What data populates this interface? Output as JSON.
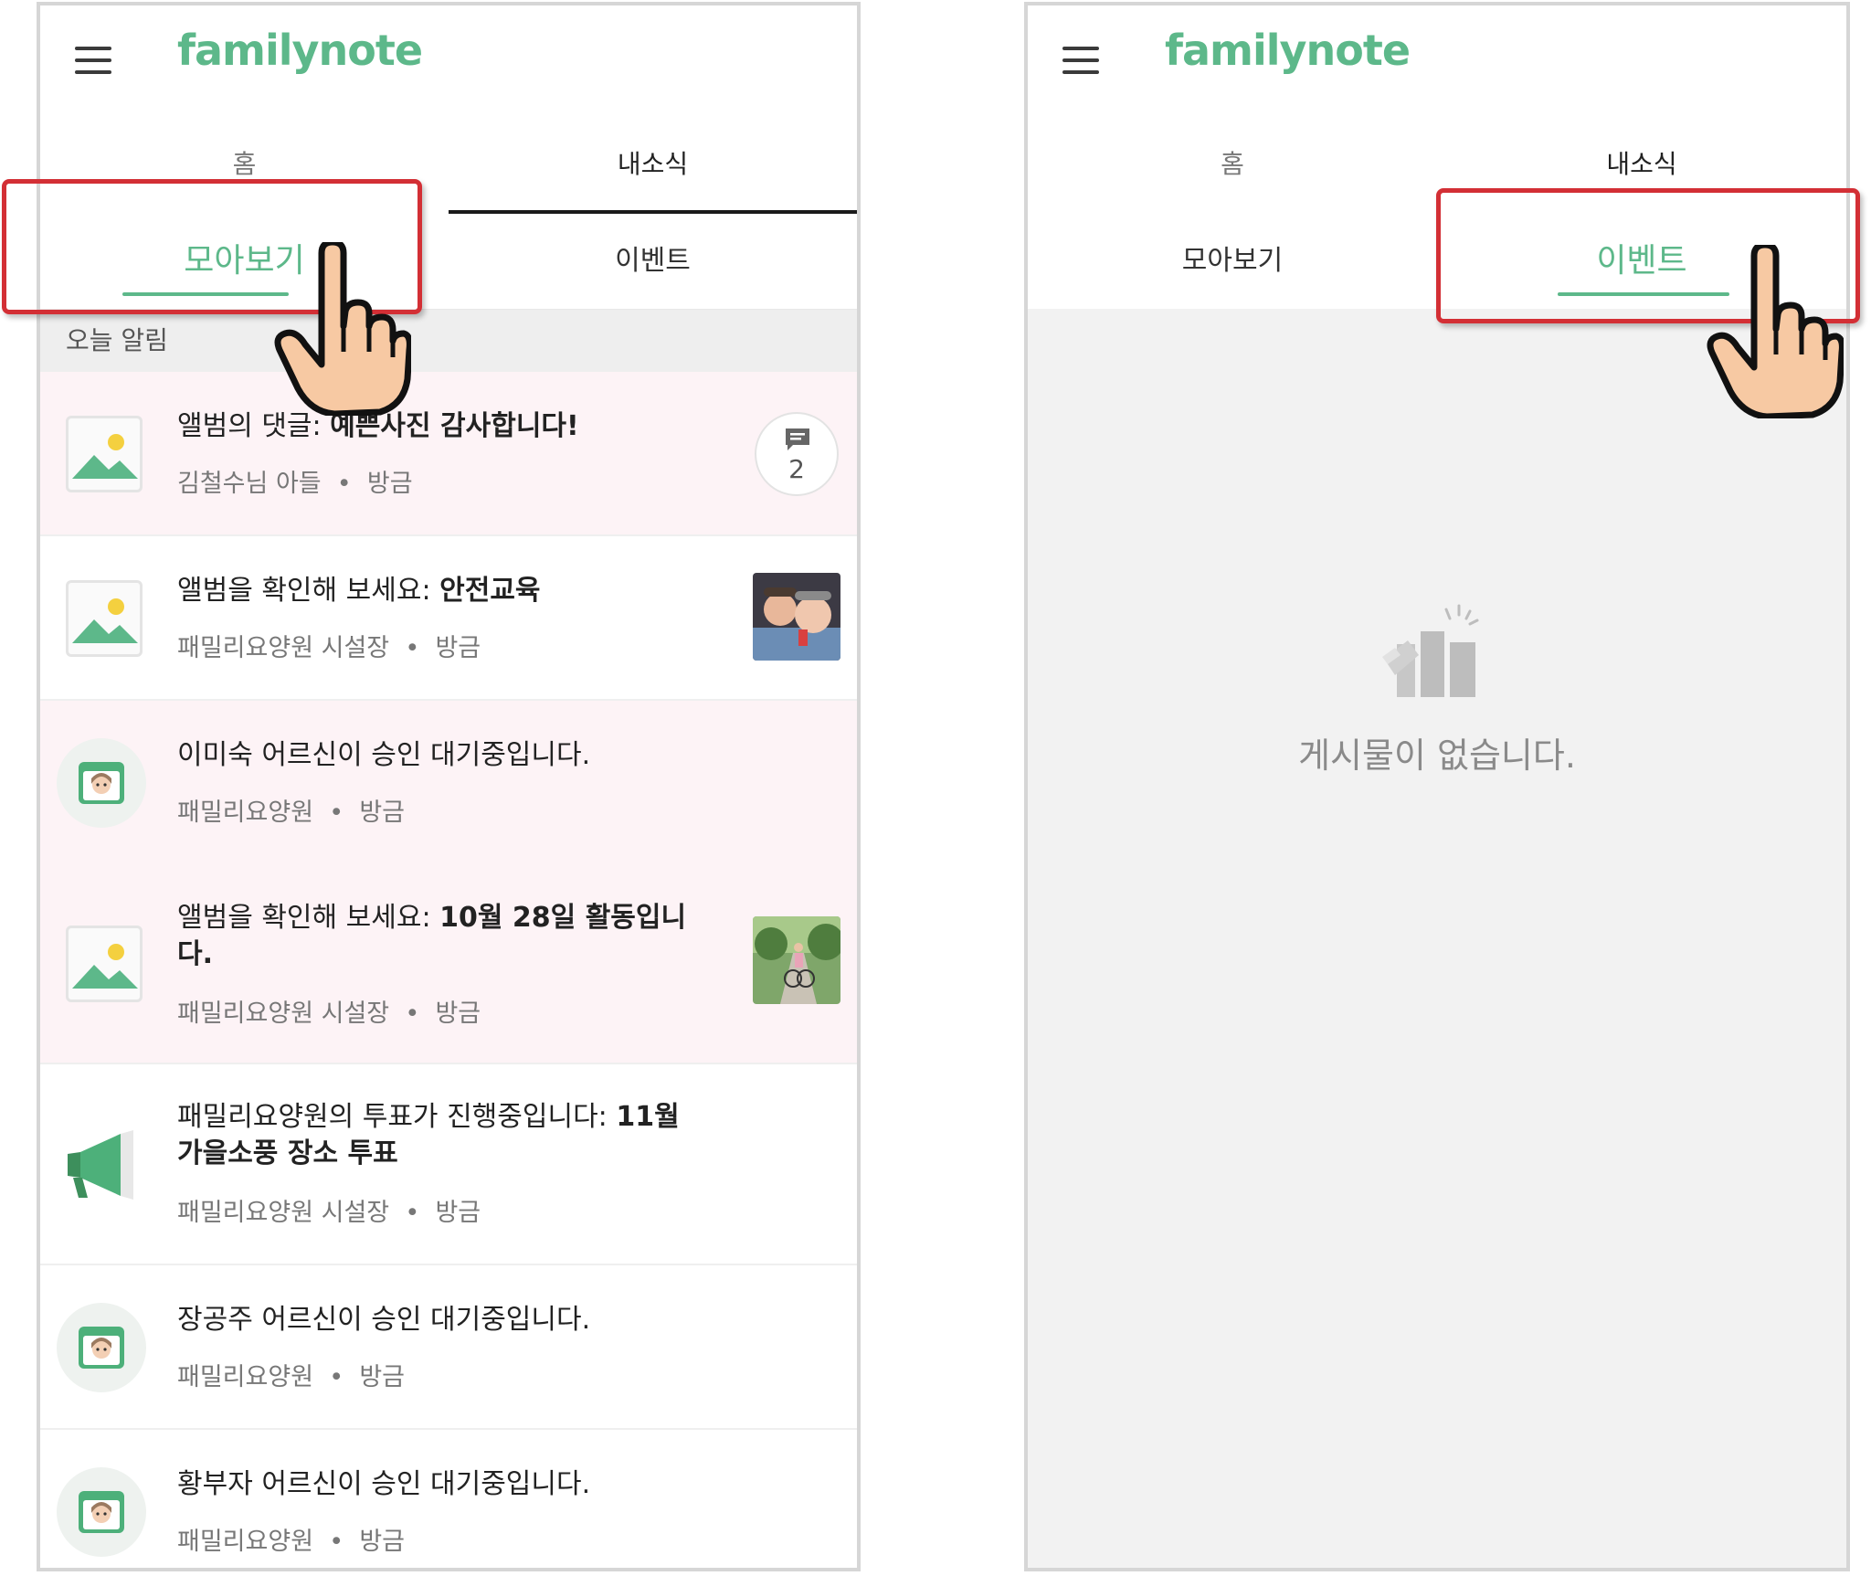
{
  "app": {
    "logo": "familynote"
  },
  "left": {
    "top_tabs": [
      "홈",
      "내소식"
    ],
    "sub_tabs": [
      "모아보기",
      "이벤트"
    ],
    "section_header": "오늘 알림",
    "items": [
      {
        "title_prefix": "앨범의 댓글: ",
        "title_bold": "예쁜사진 감사합니다!",
        "author": "김철수님 아들",
        "time": "방금",
        "comment_count": "2",
        "icon": "image-placeholder-icon",
        "background": "#fdf3f6"
      },
      {
        "title_prefix": "앨범을 확인해 보세요: ",
        "title_bold": "안전교육",
        "author": "패밀리요양원 시설장",
        "time": "방금",
        "icon": "image-placeholder-icon",
        "thumbnail": "elderly-couple-photo",
        "background": "#ffffff"
      },
      {
        "title_prefix": "이미숙 어르신이 승인 대기중입니다.",
        "title_bold": "",
        "author": "패밀리요양원",
        "time": "방금",
        "icon": "resident-calendar-icon",
        "background": "#fdf3f6"
      },
      {
        "title_prefix": "앨범을 확인해 보세요: ",
        "title_bold": "10월 28일 활동입니다.",
        "author": "패밀리요양원 시설장",
        "time": "방금",
        "icon": "image-placeholder-icon",
        "thumbnail": "bicycle-park-photo",
        "background": "#fdf3f6"
      },
      {
        "title_prefix": "패밀리요양원의 투표가 진행중입니다: ",
        "title_bold": "11월 가을소풍 장소 투표",
        "author": "패밀리요양원 시설장",
        "time": "방금",
        "icon": "megaphone-icon",
        "background": "#ffffff"
      },
      {
        "title_prefix": "장공주 어르신이 승인 대기중입니다.",
        "title_bold": "",
        "author": "패밀리요양원",
        "time": "방금",
        "icon": "resident-calendar-icon",
        "background": "#ffffff"
      },
      {
        "title_prefix": "황부자 어르신이 승인 대기중입니다.",
        "title_bold": "",
        "author": "패밀리요양원",
        "time": "방금",
        "icon": "resident-calendar-icon",
        "background": "#ffffff"
      }
    ]
  },
  "right": {
    "top_tabs": [
      "홈",
      "내소식"
    ],
    "sub_tabs": [
      "모아보기",
      "이벤트"
    ],
    "empty_message": "게시물이 없습니다."
  },
  "meta_separator": "•",
  "colors": {
    "brand": "#5db88a",
    "highlight": "#d32f35",
    "pink_row": "#fdf3f6",
    "empty_bg": "#f2f2f2"
  }
}
